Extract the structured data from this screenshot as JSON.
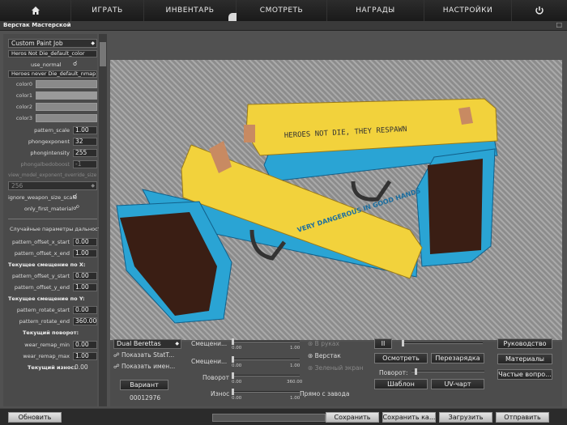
{
  "nav": {
    "home_icon": "home-icon",
    "play": "ИГРАТЬ",
    "inventory": "ИНВЕНТАРЬ",
    "watch": "СМОТРЕТЬ",
    "rewards": "НАГРАДЫ",
    "settings": "НАСТРОЙКИ",
    "power_icon": "power-icon"
  },
  "window": {
    "title": "Верстак Мастерской",
    "close": "□"
  },
  "left": {
    "paint_type": "Custom Paint Job",
    "texture_color": "Heros Not Die_default_color",
    "use_normal": "use_normal",
    "texture_normal": "Heroes never Die_default_nmap",
    "colors": [
      "color0",
      "color1",
      "color2",
      "color3"
    ],
    "pattern_scale": {
      "label": "pattern_scale",
      "value": "1.00"
    },
    "phongexponent": {
      "label": "phongexponent",
      "value": "32"
    },
    "phongintensity": {
      "label": "phongintensity",
      "value": "255"
    },
    "phongalbedoboost": {
      "label": "phongalbedoboost",
      "value": "-1"
    },
    "view_model_exponent": {
      "label": "view_model_exponent_override_size",
      "value": "256"
    },
    "ignore_weapon_size_scale": "ignore_weapon_size_scale",
    "only_first_material": "only_first_material",
    "random_header": "Случайные параметры дальности:",
    "pattern_offset_x_start": {
      "label": "pattern_offset_x_start",
      "value": "0.00"
    },
    "pattern_offset_x_end": {
      "label": "pattern_offset_x_end",
      "value": "1.00"
    },
    "current_offset_x": "Текущее смещение по X:",
    "pattern_offset_y_start": {
      "label": "pattern_offset_y_start",
      "value": "0.00"
    },
    "pattern_offset_y_end": {
      "label": "pattern_offset_y_end",
      "value": "1.00"
    },
    "current_offset_y": "Текущее смещение по Y:",
    "pattern_rotate_start": {
      "label": "pattern_rotate_start",
      "value": "0.00"
    },
    "pattern_rotate_end": {
      "label": "pattern_rotate_end",
      "value": "360.00"
    },
    "current_rotation": "Текущий поворот:",
    "wear_remap_min": {
      "label": "wear_remap_min",
      "value": "0.00"
    },
    "wear_remap_max": {
      "label": "wear_remap_max",
      "value": "1.00"
    },
    "current_wear": "Текущий износ:",
    "current_wear_value": "0.00"
  },
  "preview": {
    "text_left": "VERY DANGEROUS IN GOOD HANDS",
    "text_right": "HEROES NOT DIE, THEY RESPAWN",
    "colors": {
      "gold": "#f2d23c",
      "blue": "#2aa4d4",
      "grip": "#3a1e14",
      "bronze": "#c88a62"
    }
  },
  "bottom": {
    "weapon": "Dual Berettas",
    "show_stattrak": "Показать StatT...",
    "show_name": "Показать имен...",
    "variant_btn": "Вариант",
    "variant_value": "00012976",
    "offset1": "Смещени...",
    "offset2": "Смещени...",
    "rotation": "Поворот",
    "wear": "Износ",
    "s1_min": "0.00",
    "s1_max": "1.00",
    "s2_min": "0.00",
    "s2_max": "1.00",
    "s3_min": "0.00",
    "s3_max": "360.00",
    "s4_min": "0.00",
    "s4_max": "1.00",
    "factory_new": "Прямо с завода",
    "in_hands": "В руках",
    "workbench": "Верстак",
    "green_screen": "Зеленый экран",
    "pause": "II",
    "inspect": "Осмотреть",
    "reload": "Перезарядка",
    "rotation2": "Поворот:",
    "template": "Шаблон",
    "uv_chart": "UV-чарт",
    "guide": "Руководство",
    "materials": "Материалы",
    "faq": "Частые вопро..."
  },
  "status": {
    "refresh": "Обновить",
    "save": "Сохранить",
    "save_as": "Сохранить ка...",
    "load": "Загрузить",
    "submit": "Отправить"
  }
}
